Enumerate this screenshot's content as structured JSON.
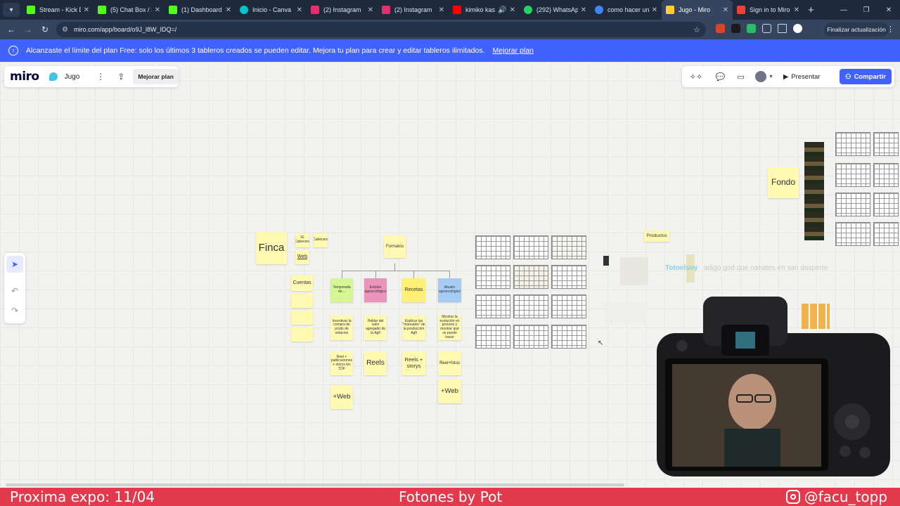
{
  "browser": {
    "tabs": [
      {
        "title": "Stream - Kick D",
        "color": "#53fc18"
      },
      {
        "title": "(5) Chat Box / S",
        "color": "#53fc18"
      },
      {
        "title": "(1) Dashboard",
        "color": "#53fc18"
      },
      {
        "title": "Inicio - Canva",
        "color": "#00c4cc"
      },
      {
        "title": "(2) Instagram",
        "color": "#e1306c"
      },
      {
        "title": "(2) Instagram",
        "color": "#e1306c"
      },
      {
        "title": "kimiko kas",
        "color": "#ff0000"
      },
      {
        "title": "(292) WhatsAp",
        "color": "#25d366"
      },
      {
        "title": "como hacer un",
        "color": "#4285f4"
      },
      {
        "title": "Jugo - Miro",
        "color": "#ffd02f"
      },
      {
        "title": "Sign in to Miro",
        "color": "#ea4335"
      }
    ],
    "url": "miro.com/app/board/o9J_l8W_IDQ=/",
    "update_label": "Finalizar actualización"
  },
  "banner": {
    "text": "Alcanzaste el límite del plan Free: solo los últimos 3 tableros creados se pueden editar. Mejora tu plan para crear y editar tableros ilimitados.",
    "link": "Mejorar plan"
  },
  "miro": {
    "logo": "miro",
    "board_name": "Jugo",
    "upgrade": "Mejorar plan",
    "present": "Presentar",
    "share": "Compartir"
  },
  "board": {
    "notes": {
      "finca": "Finca",
      "ig_cabecera": "IG Cabecera",
      "cabecera": "Cabecera",
      "web": "Web",
      "formatos": "Formatos",
      "cuentas": "Cuentas",
      "temporada": "Temporada de...",
      "estudio": "Estudio agroecológico",
      "recetas": "Recetas",
      "abuelo": "Abuelo agroecológico",
      "incentivar": "Incentivar la compra de prods de estacion",
      "hablar": "Hablar del valor agregado de la Agfl",
      "explicar": "Explicar las \"manuales\" de la producción Agfl",
      "mostrar": "Mostrar la evolución en proceso y mostrar qué se puede hacer",
      "reel_pub": "Reel + publicaciones + storys tec TDF",
      "reels": "Reels",
      "reels_storys": "Reels + storys",
      "reel_fotos": "Reel+fotos",
      "web_plus_1": "+Web",
      "web_plus_2": "+Web",
      "productos": "Productos",
      "fondo": "Fondo"
    },
    "faded_text": "Totoelsoy",
    "faded_tail": "adigo god que oanates en san dasperte"
  },
  "overlay": {
    "left": "Proxima expo: 11/04",
    "center": "Fotones by Pot",
    "right": "@facu_topp"
  }
}
